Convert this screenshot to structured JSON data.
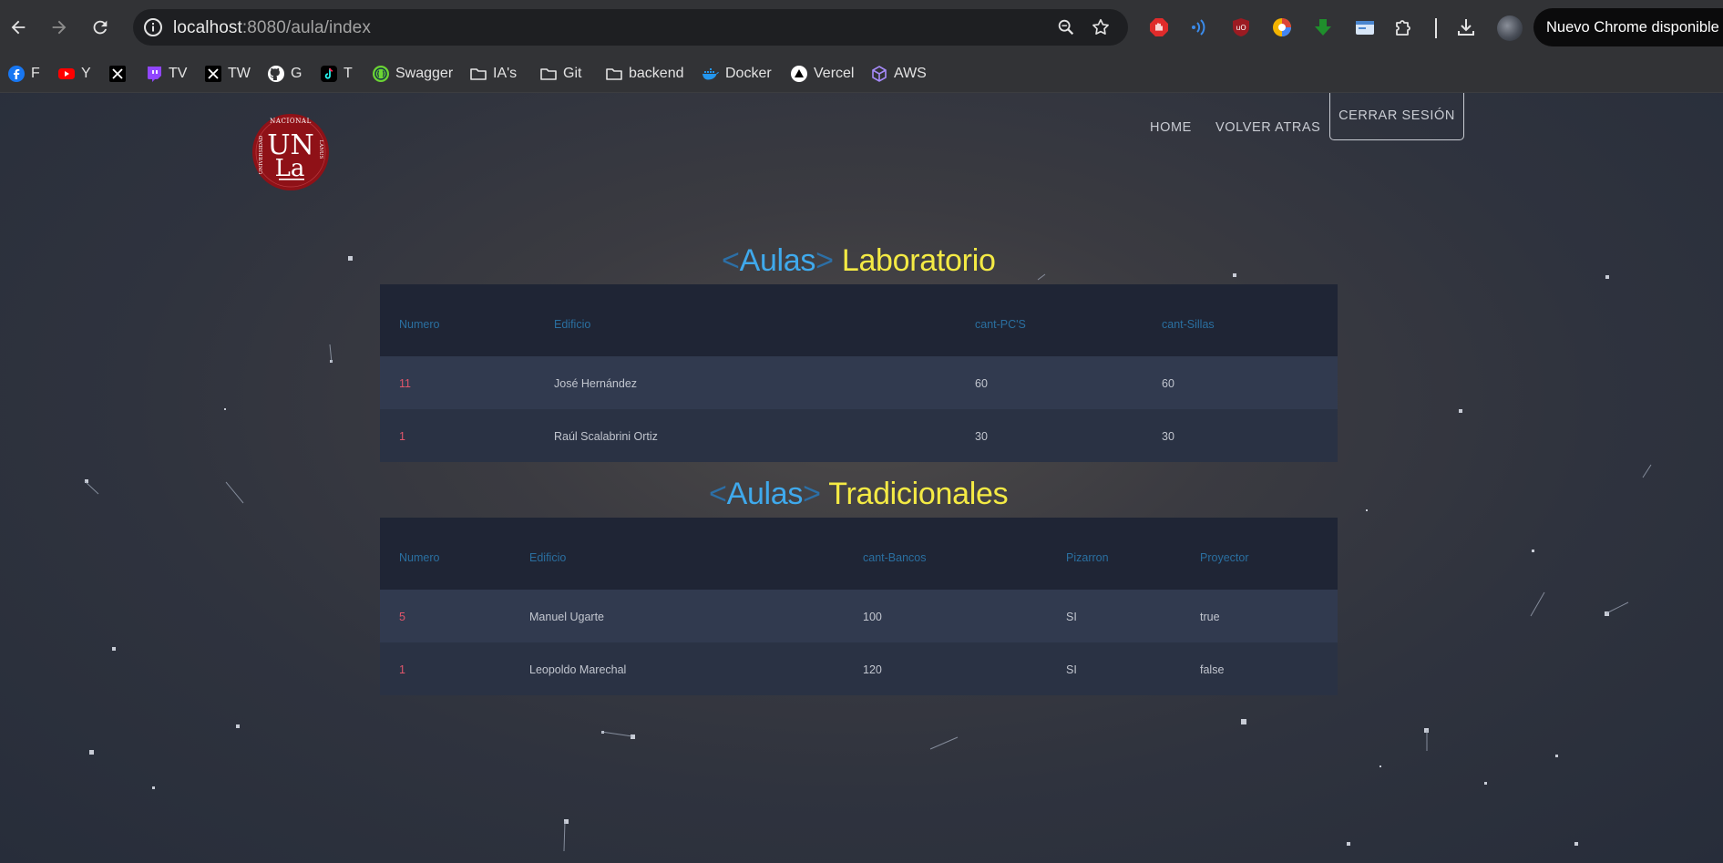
{
  "browser": {
    "url_host": "localhost",
    "url_path": ":8080/aula/index",
    "update_label": "Nuevo Chrome disponible",
    "bookmarks": [
      {
        "label": "F",
        "icon": "facebook-icon"
      },
      {
        "label": "Y",
        "icon": "youtube-icon"
      },
      {
        "label": "",
        "icon": "x-icon"
      },
      {
        "label": "TV",
        "icon": "twitch-icon"
      },
      {
        "label": "TW",
        "icon": "x-icon"
      },
      {
        "label": "G",
        "icon": "github-icon"
      },
      {
        "label": "T",
        "icon": "tiktok-icon"
      },
      {
        "label": "Swagger",
        "icon": "swagger-icon"
      },
      {
        "label": "IA's",
        "icon": "folder-icon"
      },
      {
        "label": "Git",
        "icon": "folder-icon"
      },
      {
        "label": "backend",
        "icon": "folder-icon"
      },
      {
        "label": "Docker",
        "icon": "docker-icon"
      },
      {
        "label": "Vercel",
        "icon": "vercel-icon"
      },
      {
        "label": "AWS",
        "icon": "aws-icon"
      }
    ]
  },
  "nav": {
    "home": "HOME",
    "back": "VOLVER ATRAS",
    "logout": "CERRAR SESIÓN"
  },
  "logo": {
    "top_text": "NACIONAL",
    "left_text": "UNIVERSIDAD",
    "right_text": "LANUS",
    "main_top": "UN",
    "main_bottom": "La"
  },
  "laboratorio": {
    "open_bracket": "<",
    "tag": "Aulas",
    "close_bracket": ">",
    "rest": "Laboratorio",
    "headers": [
      "Numero",
      "Edificio",
      "cant-PC'S",
      "cant-Sillas"
    ],
    "rows": [
      [
        "11",
        "José Hernández",
        "60",
        "60"
      ],
      [
        "1",
        "Raúl Scalabrini Ortiz",
        "30",
        "30"
      ]
    ]
  },
  "tradicionales": {
    "open_bracket": "<",
    "tag": "Aulas",
    "close_bracket": ">",
    "rest": "Tradicionales",
    "headers": [
      "Numero",
      "Edificio",
      "cant-Bancos",
      "Pizarron",
      "Proyector"
    ],
    "rows": [
      [
        "5",
        "Manuel Ugarte",
        "100",
        "SI",
        "true"
      ],
      [
        "1",
        "Leopoldo Marechal",
        "120",
        "SI",
        "false"
      ]
    ]
  },
  "colors": {
    "title_tag": "#3fa9ec",
    "title_rest": "#f4ea44",
    "number_cell": "#e0566b",
    "header_text": "#2a6fa0"
  }
}
